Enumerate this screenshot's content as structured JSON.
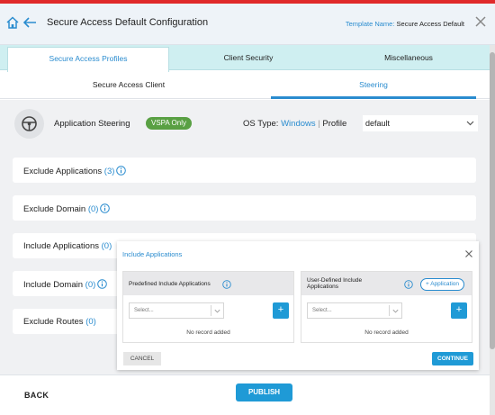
{
  "header": {
    "title": "Secure Access Default Configuration",
    "template_key": "Template Name:",
    "template_value": "Secure Access Default"
  },
  "tabs": [
    {
      "label": "Secure Access Profiles",
      "active": true
    },
    {
      "label": "Client Security",
      "active": false
    },
    {
      "label": "Miscellaneous",
      "active": false
    }
  ],
  "subtabs": [
    {
      "label": "Secure Access Client",
      "active": false
    },
    {
      "label": "Steering",
      "active": true
    }
  ],
  "steering": {
    "label": "Application Steering",
    "badge": "VSPA Only",
    "os_type_label": "OS Type:",
    "os_type_value": "Windows",
    "separator": "|",
    "profile_label": "Profile",
    "profile_value": "default"
  },
  "cards": [
    {
      "label": "Exclude Applications",
      "count": "(3)"
    },
    {
      "label": "Exclude Domain",
      "count": "(0)"
    },
    {
      "label": "Include Applications",
      "count": "(0)"
    },
    {
      "label": "Include Domain",
      "count": "(0)"
    },
    {
      "label": "Exclude Routes",
      "count": "(0)"
    }
  ],
  "modal": {
    "title": "Include Applications",
    "left_panel": {
      "title": "Predefined Include Applications",
      "select_placeholder": "Select...",
      "add_label": "+",
      "empty_text": "No record added"
    },
    "right_panel": {
      "title": "User-Defined Include Applications",
      "add_app_label": "+ Application",
      "select_placeholder": "Select...",
      "add_label": "+",
      "empty_text": "No record added"
    },
    "cancel_label": "CANCEL",
    "continue_label": "CONTINUE"
  },
  "footer": {
    "back_label": "BACK",
    "publish_label": "PUBLISH"
  },
  "colors": {
    "accent": "#2a8ccf",
    "primary_button": "#1f9ad6",
    "badge": "#59a043",
    "top_bar": "#e02a2a",
    "tab_bar": "#cfeff1"
  }
}
